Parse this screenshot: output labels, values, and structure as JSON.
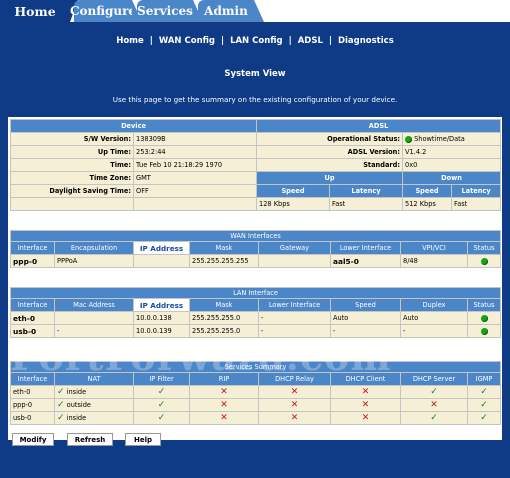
{
  "nav": {
    "tabs": [
      "Home",
      "Configure",
      "Services",
      "Admin"
    ],
    "links": [
      "Home",
      "WAN Config",
      "LAN Config",
      "ADSL",
      "Diagnostics"
    ]
  },
  "page": {
    "title": "System View",
    "description": "Use this page to get the summary on the existing configuration of your device."
  },
  "device": {
    "header": "Device",
    "rows": [
      {
        "label": "S/W Version:",
        "value": "138309B"
      },
      {
        "label": "Up Time:",
        "value": "253:2:44"
      },
      {
        "label": "Time:",
        "value": "Tue Feb 10 21:18:29 1970"
      },
      {
        "label": "Time Zone:",
        "value": "GMT"
      },
      {
        "label": "Daylight Saving Time:",
        "value": "OFF"
      }
    ]
  },
  "adsl": {
    "header": "ADSL",
    "operational_status_label": "Operational Status:",
    "operational_status": "Showtime/Data",
    "version_label": "ADSL Version:",
    "version": "V1.4.2",
    "standard_label": "Standard:",
    "standard": "0x0",
    "up_label": "Up",
    "down_label": "Down",
    "speed_label": "Speed",
    "latency_label": "Latency",
    "up_speed": "128 Kbps",
    "up_latency": "Fast",
    "down_speed": "512 Kbps",
    "down_latency": "Fast"
  },
  "wan": {
    "title": "WAN Interfaces",
    "columns": [
      "Interface",
      "Encapsulation",
      "IP Address",
      "Mask",
      "Gateway",
      "Lower Interface",
      "VPI/VCI",
      "Status"
    ],
    "rows": [
      {
        "interface": "ppp-0",
        "encapsulation": "PPPoA",
        "ip": "",
        "mask": "255.255.255.255",
        "gateway": "",
        "lower": "aal5-0",
        "vpivci": "8/48",
        "status": "up"
      }
    ]
  },
  "lan": {
    "title": "LAN Interface",
    "columns": [
      "Interface",
      "Mac Address",
      "IP Address",
      "Mask",
      "Lower Interface",
      "Speed",
      "Duplex",
      "Status"
    ],
    "rows": [
      {
        "interface": "eth-0",
        "mac": "",
        "ip": "10.0.0.138",
        "mask": "255.255.255.0",
        "lower": "-",
        "speed": "Auto",
        "duplex": "Auto",
        "status": "up"
      },
      {
        "interface": "usb-0",
        "mac": "-",
        "ip": "10.0.0.139",
        "mask": "255.255.255.0",
        "lower": "-",
        "speed": "-",
        "duplex": "-",
        "status": "up"
      }
    ]
  },
  "services": {
    "title": "Services Summary",
    "columns": [
      "Interface",
      "NAT",
      "IP Filter",
      "RIP",
      "DHCP Relay",
      "DHCP Client",
      "DHCP Server",
      "IGMP"
    ],
    "rows": [
      {
        "interface": "eth-0",
        "nat": "inside",
        "ipfilter": true,
        "rip": false,
        "dhcprelay": false,
        "dhcpclient": false,
        "dhcpserver": true,
        "igmp": true
      },
      {
        "interface": "ppp-0",
        "nat": "outside",
        "ipfilter": true,
        "rip": false,
        "dhcprelay": false,
        "dhcpclient": false,
        "dhcpserver": false,
        "igmp": true
      },
      {
        "interface": "usb-0",
        "nat": "inside",
        "ipfilter": true,
        "rip": false,
        "dhcprelay": false,
        "dhcpclient": false,
        "dhcpserver": true,
        "igmp": true
      }
    ]
  },
  "watermark": "PortForward.com",
  "buttons": {
    "modify": "Modify",
    "refresh": "Refresh",
    "help": "Help"
  },
  "colors": {
    "background": "#0e3a86",
    "header": "#4a86c8",
    "cell": "#f5efd6",
    "status_up": "#16a316",
    "cross": "#c41818",
    "check": "#1f7a1f"
  }
}
